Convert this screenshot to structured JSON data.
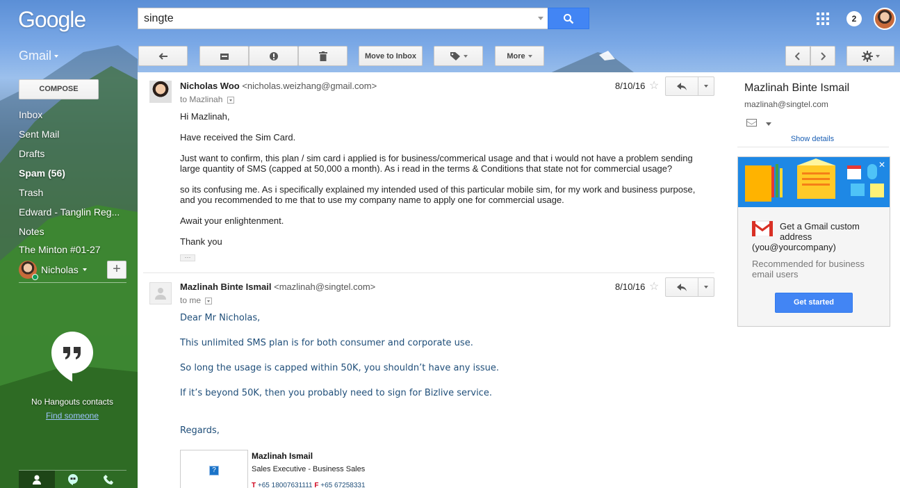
{
  "search": {
    "query": "singte"
  },
  "header": {
    "logo": "Google",
    "notifications": "2"
  },
  "toolbar": {
    "app_label": "Gmail",
    "move_to_inbox": "Move to Inbox",
    "more": "More"
  },
  "sidebar": {
    "compose": "COMPOSE",
    "items": [
      {
        "label": "Inbox",
        "bold": false
      },
      {
        "label": "Sent Mail",
        "bold": false
      },
      {
        "label": "Drafts",
        "bold": false
      },
      {
        "label": "Spam (56)",
        "bold": true
      },
      {
        "label": "Trash",
        "bold": false
      },
      {
        "label": "Edward - Tanglin Reg...",
        "bold": false
      },
      {
        "label": "Notes",
        "bold": false
      },
      {
        "label": "The Minton #01-27",
        "bold": false
      }
    ],
    "hangouts_user": "Nicholas",
    "no_contacts": "No Hangouts contacts",
    "find_someone": "Find someone"
  },
  "messages": [
    {
      "sender_name": "Nicholas Woo",
      "sender_email": "<nicholas.weizhang@gmail.com>",
      "to": "to Mazlinah",
      "date": "8/10/16",
      "body": [
        "Hi Mazlinah,",
        "Have received the Sim Card.",
        "Just want to confirm, this plan / sim card i applied is for business/commerical usage and that i would not have a problem sending large quantity of SMS (capped at 50,000 a month). As i read in the terms & Conditions that state not for commercial usage?",
        "so its confusing me. As i specifically explained my intended used of this particular mobile sim, for my work and business purpose, and you recommended to me that to use my company name to apply one for commercial usage.",
        "Await your enlightenment.",
        "Thank you"
      ]
    },
    {
      "sender_name": "Mazlinah Binte Ismail",
      "sender_email": "<mazlinah@singtel.com>",
      "to": "to me",
      "date": "8/10/16",
      "body": [
        "Dear Mr Nicholas,",
        "This unlimited SMS plan is for both consumer and corporate use.",
        "So long the usage is capped within 50K, you shouldn’t have any issue.",
        "If it’s beyond 50K, then you probably need to sign for Bizlive service.",
        "Regards,"
      ],
      "signature": {
        "name": "Mazlinah Ismail",
        "title": "Sales Executive - Business Sales",
        "phone_label": "T",
        "phone": "+65 18007631111",
        "fax_label": "F",
        "fax": "+65 67258331"
      }
    }
  ],
  "side_panel": {
    "contact_name": "Mazlinah Binte Ismail",
    "contact_email": "mazlinah@singtel.com",
    "show_details": "Show details",
    "promo": {
      "title": "Get a Gmail custom address",
      "title2": "(you@yourcompany)",
      "subtitle": "Recommended for business email users",
      "button": "Get started"
    }
  },
  "colors": {
    "accent_blue": "#4285f4",
    "reply_text_blue": "#1f4e79",
    "signature_red": "#d0021b"
  }
}
